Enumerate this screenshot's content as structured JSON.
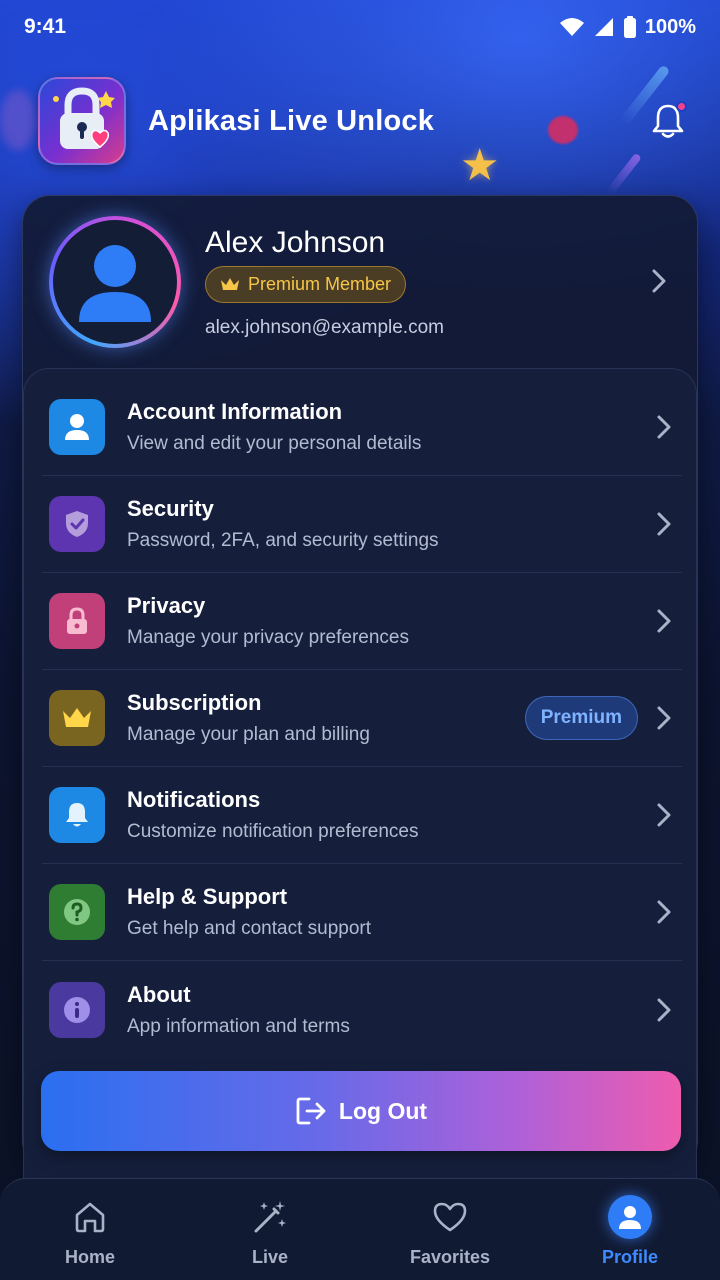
{
  "status_bar": {
    "time": "9:41",
    "battery": "100%"
  },
  "header": {
    "app_title": "Aplikasi Live Unlock",
    "logo_icon": "lock-heart-logo",
    "notification_icon": "bell-icon"
  },
  "profile": {
    "name": "Alex Johnson",
    "badge": "Premium Member",
    "email": "alex.johnson@example.com"
  },
  "menu": {
    "items": [
      {
        "title": "Account Information",
        "subtitle": "View and edit your personal details",
        "icon": "user-icon",
        "color": "#1e88e5"
      },
      {
        "title": "Security",
        "subtitle": "Password, 2FA, and security settings",
        "icon": "shield-check-icon",
        "color": "#5e35b1"
      },
      {
        "title": "Privacy",
        "subtitle": "Manage your privacy preferences",
        "icon": "lock-icon",
        "color": "#c2407a"
      },
      {
        "title": "Subscription",
        "subtitle": "Manage your plan and billing",
        "icon": "crown-icon",
        "color": "#7a6520",
        "tag": "Premium"
      },
      {
        "title": "Notifications",
        "subtitle": "Customize notification preferences",
        "icon": "bell-icon",
        "color": "#1e88e5"
      },
      {
        "title": "Help & Support",
        "subtitle": "Get help and contact support",
        "icon": "question-icon",
        "color": "#2e7d32"
      },
      {
        "title": "About",
        "subtitle": "App information and terms",
        "icon": "info-icon",
        "color": "#4a3aa0"
      }
    ]
  },
  "logout": {
    "label": "Log Out"
  },
  "bottom_nav": {
    "items": [
      {
        "label": "Home",
        "icon": "home-icon",
        "active": false
      },
      {
        "label": "Live",
        "icon": "magic-wand-icon",
        "active": false
      },
      {
        "label": "Favorites",
        "icon": "heart-icon",
        "active": false
      },
      {
        "label": "Profile",
        "icon": "profile-icon",
        "active": true
      }
    ],
    "active_color": "#3d8bff"
  }
}
